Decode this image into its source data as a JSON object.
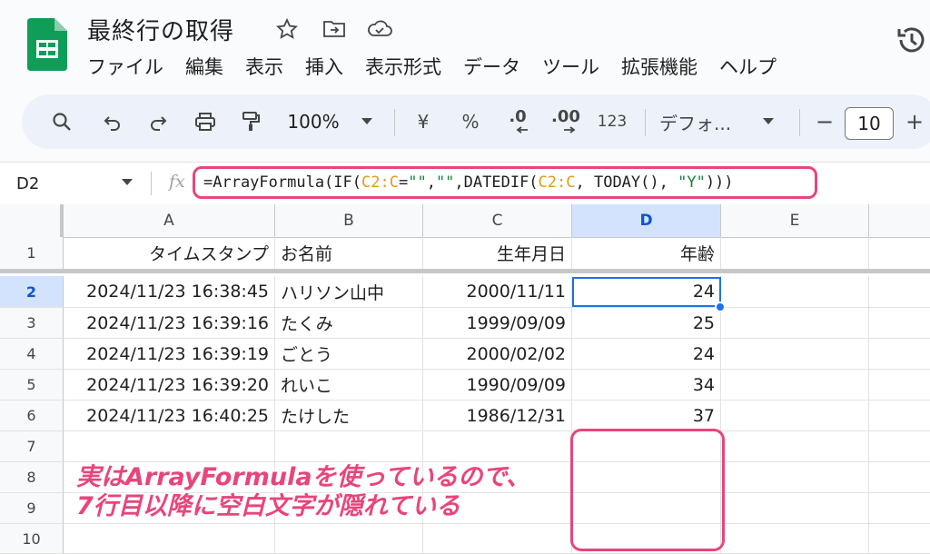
{
  "app": {
    "doc_title": "最終行の取得"
  },
  "menu": [
    "ファイル",
    "編集",
    "表示",
    "挿入",
    "表示形式",
    "データ",
    "ツール",
    "拡張機能",
    "ヘルプ"
  ],
  "toolbar": {
    "zoom": "100%",
    "currency": "¥",
    "percent": "%",
    "dec_decrease": ".0",
    "dec_increase": ".00",
    "number_format": "123",
    "font": "デフォ...",
    "minus": "−",
    "font_size": "10",
    "plus": "+"
  },
  "formula_bar": {
    "cell_ref": "D2",
    "fx": "fx",
    "formula_parts": [
      "=ArrayFormula(IF(",
      "C2:C",
      "=",
      "\"\"",
      ",",
      "\"\"",
      ",DATEDIF(",
      "C2:C",
      ", TODAY(), ",
      "\"Y\"",
      ")))"
    ]
  },
  "grid": {
    "columns": [
      "A",
      "B",
      "C",
      "D",
      "E"
    ],
    "rows": [
      "1",
      "2",
      "3",
      "4",
      "5",
      "6",
      "7",
      "8",
      "9",
      "10"
    ],
    "header_row": [
      "タイムスタンプ",
      "お名前",
      "生年月日",
      "年齢"
    ],
    "data": [
      [
        "2024/11/23 16:38:45",
        "ハリソン山中",
        "2000/11/11",
        "24"
      ],
      [
        "2024/11/23 16:39:16",
        "たくみ",
        "1999/09/09",
        "25"
      ],
      [
        "2024/11/23 16:39:19",
        "ごとう",
        "2000/02/02",
        "24"
      ],
      [
        "2024/11/23 16:39:20",
        "れいこ",
        "1990/09/09",
        "34"
      ],
      [
        "2024/11/23 16:40:25",
        "たけした",
        "1986/12/31",
        "37"
      ]
    ]
  },
  "annotation": {
    "line1": "実はArrayFormulaを使っているので、",
    "line2": "7行目以降に空白文字が隠れている"
  },
  "colors": {
    "highlight": "#e8457c",
    "selection": "#1a73e8",
    "sheets_green": "#0f9d58"
  }
}
